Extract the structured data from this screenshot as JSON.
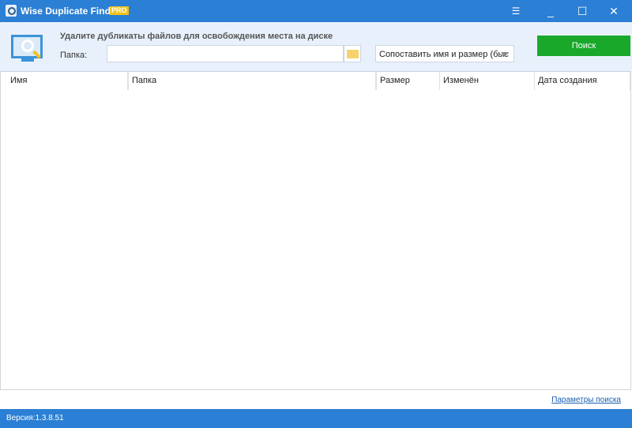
{
  "titlebar": {
    "title": "Wise Duplicate Finder",
    "badge": "PRO",
    "menu_icon": "☰",
    "minimize": "_",
    "maximize": "☐",
    "close": "✕"
  },
  "header": {
    "heading": "Удалите дубликаты файлов для освобождения места на диске",
    "folder_label": "Папка:",
    "folder_value": "",
    "match_mode": "Сопоставить имя и размер (быс",
    "search_label": "Поиск"
  },
  "table": {
    "columns": [
      "Имя",
      "Папка",
      "Размер",
      "Изменён",
      "Дата создания"
    ]
  },
  "footer": {
    "search_params_link": "Параметры поиска",
    "version": "Версия:1.3.8.51"
  }
}
